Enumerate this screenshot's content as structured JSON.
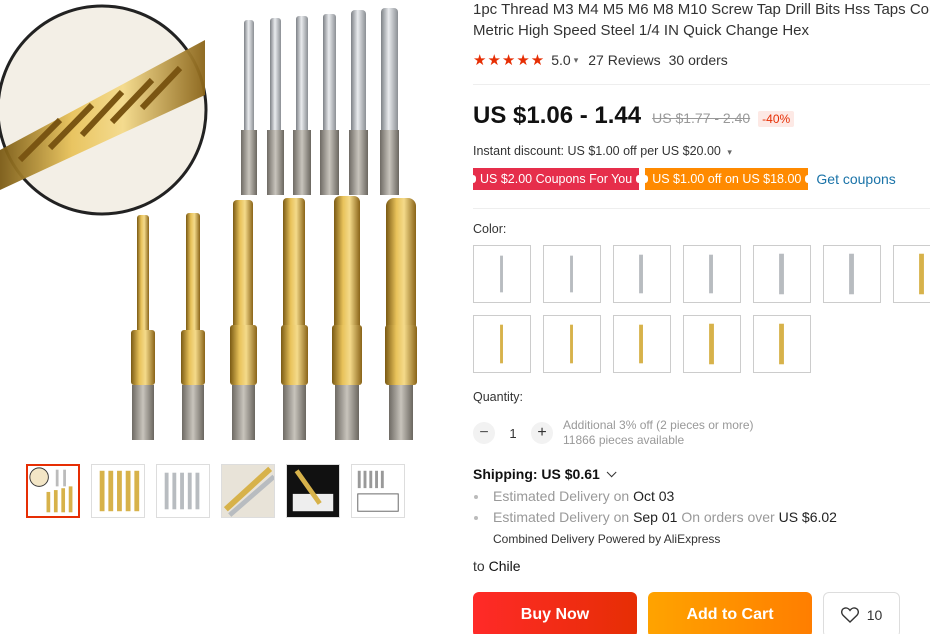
{
  "product": {
    "title_line1": "1pc Thread M3 M4 M5 M6 M8 M10 Screw Tap Drill Bits Hss Taps Count",
    "title_line2": "Metric High Speed Steel 1/4 IN Quick Change Hex"
  },
  "rating": {
    "stars": "★★★★★",
    "value": "5.0",
    "reviews": "27 Reviews",
    "orders": "30 orders"
  },
  "price": {
    "current": "US $1.06 - 1.44",
    "original": "US $1.77 - 2.40",
    "discount": "-40%"
  },
  "instant_discount": "Instant discount: US $1.00 off per US $20.00",
  "coupons": {
    "coupon1": "US $2.00 Coupons For You",
    "coupon2": "US $1.00 off on US $18.00",
    "get": "Get coupons"
  },
  "color": {
    "label": "Color:"
  },
  "quantity": {
    "label": "Quantity:",
    "value": "1",
    "minus": "−",
    "plus": "+",
    "note1": "Additional 3% off (2 pieces or more)",
    "note2": "11866 pieces available"
  },
  "shipping": {
    "label": "Shipping: US $0.61",
    "est1_prefix": "Estimated Delivery on",
    "est1_date": "Oct 03",
    "est2_prefix": "Estimated Delivery on",
    "est2_date": "Sep 01",
    "est2_mid": "On orders over",
    "est2_amount": "US $6.02",
    "combined": "Combined Delivery Powered by AliExpress",
    "to_prefix": "to",
    "country": "Chile"
  },
  "actions": {
    "buy_now": "Buy Now",
    "add_to_cart": "Add to Cart",
    "wishlist_count": "10"
  },
  "colors": {
    "brand_red": "#e62e04",
    "coupon_red": "#e62e4b",
    "coupon_orange": "#ff8a00",
    "link_blue": "#1a73a8",
    "titanium_gold": "#c9a23a",
    "steel_silver": "#b8bcc0"
  }
}
